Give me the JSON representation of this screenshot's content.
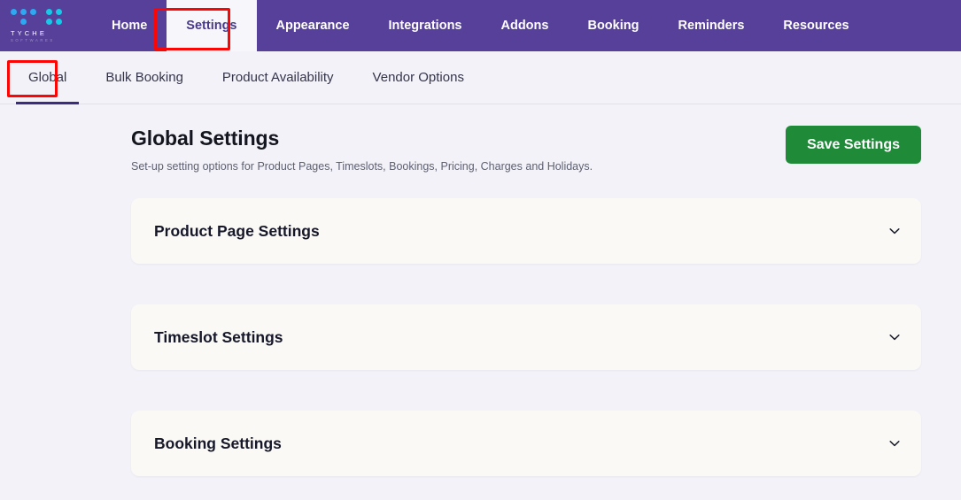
{
  "brand": {
    "name": "TYCHE",
    "tagline": "SOFTWARES",
    "logo_icon": "tyche-dots-logo",
    "dot_colors": [
      "#2ea8f0",
      "#17c9e8",
      "#1fb6e8"
    ]
  },
  "theme": {
    "header_purple": "#564099",
    "page_background": "#f3f2f8",
    "panel_background": "#faf9f6",
    "save_button_green": "#1f8a38",
    "active_tab_underline": "#3b2d7d",
    "annotation_red": "#fb0505"
  },
  "topnav": {
    "items": [
      {
        "label": "Home",
        "active": false
      },
      {
        "label": "Settings",
        "active": true
      },
      {
        "label": "Appearance",
        "active": false
      },
      {
        "label": "Integrations",
        "active": false
      },
      {
        "label": "Addons",
        "active": false
      },
      {
        "label": "Booking",
        "active": false
      },
      {
        "label": "Reminders",
        "active": false
      },
      {
        "label": "Resources",
        "active": false
      }
    ]
  },
  "subnav": {
    "tabs": [
      {
        "label": "Global",
        "active": true
      },
      {
        "label": "Bulk Booking",
        "active": false
      },
      {
        "label": "Product Availability",
        "active": false
      },
      {
        "label": "Vendor Options",
        "active": false
      }
    ]
  },
  "main": {
    "title": "Global Settings",
    "subtitle": "Set-up setting options for Product Pages, Timeslots, Bookings, Pricing, Charges and Holidays.",
    "save_label": "Save Settings",
    "panels": [
      {
        "title": "Product Page Settings",
        "expanded": false,
        "icon": "chevron-down-icon"
      },
      {
        "title": "Timeslot Settings",
        "expanded": false,
        "icon": "chevron-down-icon"
      },
      {
        "title": "Booking Settings",
        "expanded": false,
        "icon": "chevron-down-icon"
      }
    ]
  },
  "annotations": [
    {
      "target": "topnav-settings-tab"
    },
    {
      "target": "subnav-global-tab"
    }
  ]
}
